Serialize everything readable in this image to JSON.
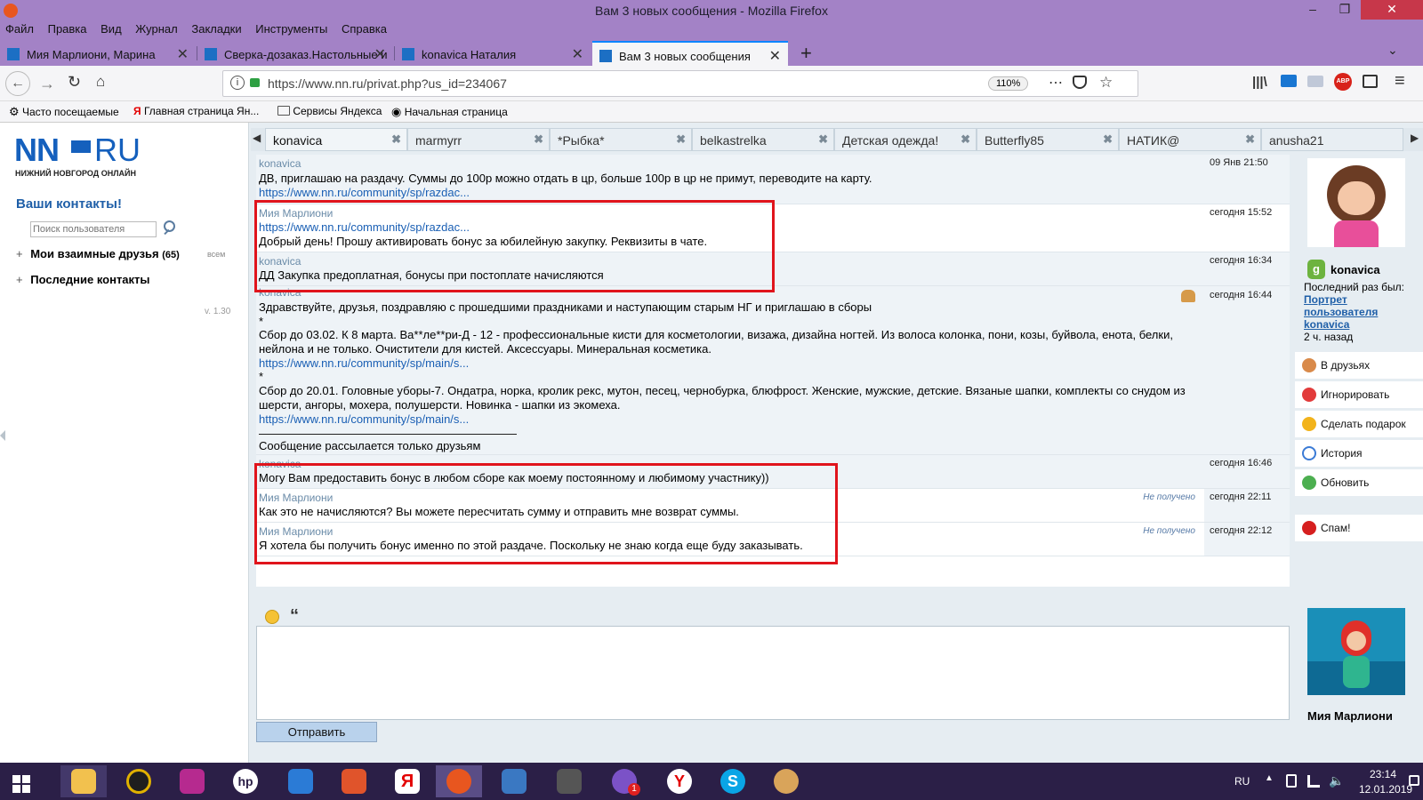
{
  "window": {
    "title": "Вам 3 новых сообщения - Mozilla Firefox"
  },
  "menu": [
    "Файл",
    "Правка",
    "Вид",
    "Журнал",
    "Закладки",
    "Инструменты",
    "Справка"
  ],
  "browser_tabs": [
    {
      "label": "Мия Марлиони, Марина"
    },
    {
      "label": "Сверка-дозаказ.Настольные и"
    },
    {
      "label": "konavica Наталия"
    },
    {
      "label": "Вам 3 новых сообщения"
    }
  ],
  "url": "https://www.nn.ru/privat.php?us_id=234067",
  "zoom": "110%",
  "bookmarks": [
    "Часто посещаемые",
    "Главная страница Ян...",
    "Сервисы Яндекса",
    "Начальная страница"
  ],
  "site": {
    "logo_nn": "NN",
    "logo_ru": "RU",
    "logo_sub": "НИЖНИЙ НОВГОРОД ОНЛАЙН",
    "contacts_title": "Ваши контакты!",
    "search_placeholder": "Поиск пользователя",
    "friends_label": "Мои взаимные друзья",
    "friends_count": "(65)",
    "friends_filter": "всем",
    "recent_label": "Последние контакты",
    "version": "v. 1.30"
  },
  "contact_tabs": [
    "konavica",
    "marmyrr",
    "*Рыбка*",
    "belkastrelka",
    "Детская одежда!",
    "Butterfly85",
    "НАТИК@",
    "anusha21"
  ],
  "messages": [
    {
      "author": "konavica",
      "time": "09 Янв 21:50",
      "lines": [
        "ДВ, приглашаю на раздачу. Суммы до 100р можно отдать в цр, больше 100р в цр не примут, переводите на карту."
      ],
      "link": "https://www.nn.ru/community/sp/razdac..."
    },
    {
      "author": "Мия Марлиони",
      "time": "сегодня 15:52",
      "link": "https://www.nn.ru/community/sp/razdac...",
      "lines": [
        "Добрый день! Прошу активировать бонус за юбилейную закупку. Реквизиты в чате."
      ]
    },
    {
      "author": "konavica",
      "time": "сегодня 16:34",
      "lines": [
        "ДД Закупка предоплатная, бонусы при постоплате начисляются"
      ]
    },
    {
      "author": "konavica",
      "time": "сегодня 16:44",
      "lines": [
        "Здравствуйте, друзья, поздравляю с прошедшими праздниками и наступающим старым НГ и приглашаю в сборы",
        "*",
        "Сбор до 03.02. К 8 марта. Ва**ле**ри-Д - 12 - профессиональные кисти для косметологии, визажа, дизайна ногтей. Из волоса колонка, пони, козы, буйвола, енота, белки,",
        "нейлона и не только. Очистители для кистей. Аксессуары. Минеральная косметика.",
        "https://www.nn.ru/community/sp/main/s...",
        "*",
        "Сбор до 20.01. Головные уборы-7. Ондатра, норка, кролик рекс, мутон, песец, чернобурка, блюфрост. Женские, мужские, детские. Вязаные шапки, комплекты со снудом из",
        "шерсти, ангоры, мохера, полушерсти. Новинка - шапки из экомеха.",
        "https://www.nn.ru/community/sp/main/s...",
        "Сообщение рассылается только друзьям"
      ]
    },
    {
      "author": "konavica",
      "time": "сегодня 16:46",
      "lines": [
        "Могу Вам предоставить бонус в любом сборе как моему постоянному и любимому участнику))"
      ]
    },
    {
      "author": "Мия Марлиони",
      "time": "сегодня 22:11",
      "status": "Не получено",
      "lines": [
        "Как это не начисляются? Вы можете пересчитать сумму и отправить мне возврат суммы."
      ]
    },
    {
      "author": "Мия Марлиони",
      "time": "сегодня 22:12",
      "status": "Не получено",
      "lines": [
        "Я хотела бы получить бонус именно по этой раздаче. Поскольку не знаю когда еще буду заказывать."
      ]
    }
  ],
  "profile": {
    "name": "konavica",
    "last_seen_label": "Последний раз был:",
    "portrait_link": "Портрет пользователя konavica",
    "ago": "2 ч. назад",
    "actions": [
      "В друзьях",
      "Игнорировать",
      "Сделать подарок",
      "История",
      "Обновить",
      "Спам!"
    ],
    "me_name": "Мия Марлиони"
  },
  "composer": {
    "send_label": "Отправить"
  },
  "taskbar": {
    "lang": "RU",
    "time": "23:14",
    "date": "12.01.2019",
    "viber_badge": "1"
  }
}
